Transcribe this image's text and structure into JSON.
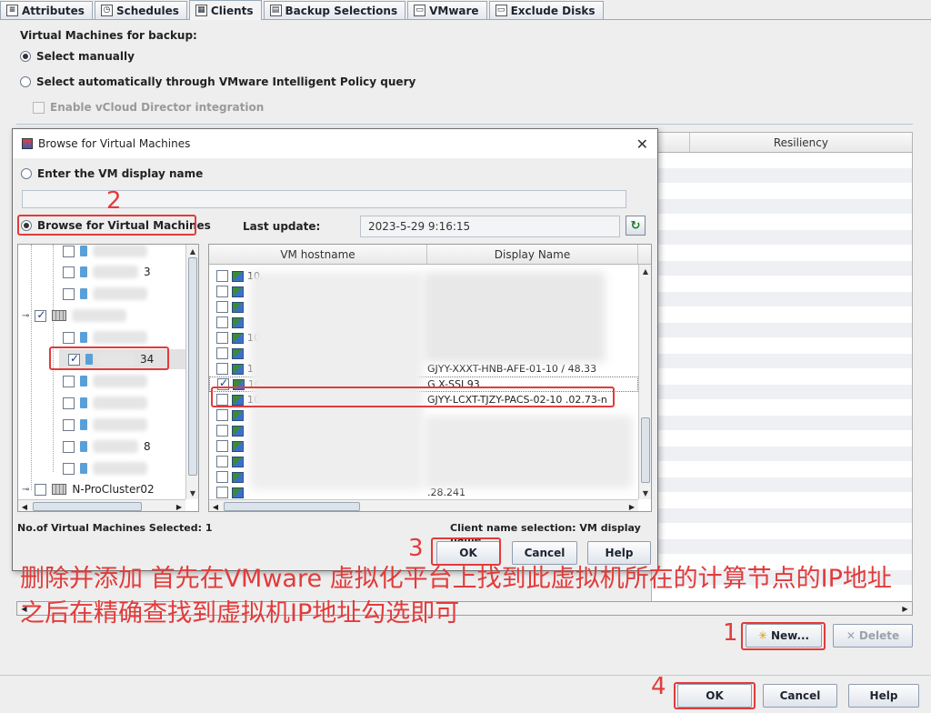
{
  "tabs": [
    {
      "label": "Attributes",
      "icon": "list-icon"
    },
    {
      "label": "Schedules",
      "icon": "clock-icon"
    },
    {
      "label": "Clients",
      "icon": "clients-icon"
    },
    {
      "label": "Backup Selections",
      "icon": "folder-icon"
    },
    {
      "label": "VMware",
      "icon": "doc-icon"
    },
    {
      "label": "Exclude Disks",
      "icon": "doc-icon"
    }
  ],
  "active_tab": "Clients",
  "main": {
    "section_title": "Virtual Machines for backup:",
    "radio_manual": "Select manually",
    "radio_auto": "Select automatically through VMware Intelligent Policy query",
    "vcloud_label": "Enable vCloud Director integration",
    "table_header_resiliency": "Resiliency",
    "new_button": "New...",
    "delete_button": "Delete"
  },
  "dialog": {
    "title": "Browse for Virtual Machines",
    "radio_enter": "Enter the VM display name",
    "radio_browse": "Browse for Virtual Machines",
    "last_update_label": "Last update:",
    "last_update_value": "2023-5-29 9:16:15",
    "col_vm_hostname": "VM hostname",
    "col_display_name": "Display Name",
    "tree_selected_suffix": "34",
    "tree_cluster": "N-ProCluster02",
    "tree_suffix_3": "3",
    "tree_suffix_8": "8",
    "vm_rows": [
      {
        "host": "10.",
        "display": "",
        "checked": false
      },
      {
        "host": "",
        "display": "",
        "checked": false
      },
      {
        "host": "",
        "display": "",
        "checked": false
      },
      {
        "host": "",
        "display": "",
        "checked": false
      },
      {
        "host": "10.",
        "display": "",
        "checked": false
      },
      {
        "host": "",
        "display": "",
        "checked": false
      },
      {
        "host": "1",
        "display": "GJYY-XXXT-HNB-AFE-01-10 / 48.33",
        "checked": false
      },
      {
        "host": "10.      93",
        "display": "G          X-SSI            93",
        "checked": true
      },
      {
        "host": "10.      73",
        "display": "GJYY-LCXT-TJZY-PACS-02-10        .02.73-n",
        "checked": false
      },
      {
        "host": "",
        "display": "",
        "checked": false
      },
      {
        "host": "",
        "display": "",
        "checked": false
      },
      {
        "host": "",
        "display": "",
        "checked": false
      },
      {
        "host": "",
        "display": "",
        "checked": false
      },
      {
        "host": "",
        "display": "",
        "checked": false
      },
      {
        "host": "",
        "display": "            .28.241",
        "checked": false
      }
    ],
    "selected_count": "No.of Virtual Machines Selected: 1",
    "client_name_selection": "Client name selection: VM display name",
    "ok": "OK",
    "cancel": "Cancel",
    "help": "Help"
  },
  "bottom": {
    "ok": "OK",
    "cancel": "Cancel",
    "help": "Help"
  },
  "annotation": {
    "text": "删除并添加  首先在VMware 虚拟化平台上找到此虚拟机所在的计算节点的IP地址 之后在精确查找到虚拟机IP地址勾选即可",
    "n1": "1",
    "n2": "2",
    "n3": "3",
    "n4": "4",
    "color": "#e23b3b"
  }
}
